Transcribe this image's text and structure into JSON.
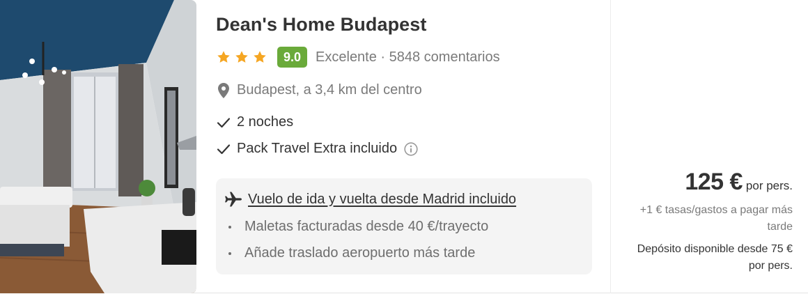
{
  "hotel": {
    "name": "Dean's Home Budapest",
    "stars": 3,
    "score": "9.0",
    "rating_summary": "Excelente · 5848 comentarios",
    "location": "Budapest, a 3,4 km del centro",
    "features": [
      "2 noches",
      "Pack Travel Extra incluido"
    ]
  },
  "flight": {
    "main": "Vuelo de ida y vuelta desde Madrid incluido",
    "bullets": [
      "Maletas facturadas desde 40 €/trayecto",
      "Añade traslado aeropuerto más tarde"
    ]
  },
  "price": {
    "amount": "125 €",
    "per": "por pers.",
    "fees": "+1 € tasas/gastos a pagar más tarde",
    "deposit": "Depósito disponible desde 75 € por pers."
  },
  "colors": {
    "star": "#f5a623",
    "score_badge": "#6aaa3a",
    "text": "#333333",
    "muted": "#7a7a7a"
  },
  "icons": {
    "location": "map-pin-icon",
    "check": "check-icon",
    "info": "info-icon",
    "flight": "airplane-icon"
  }
}
